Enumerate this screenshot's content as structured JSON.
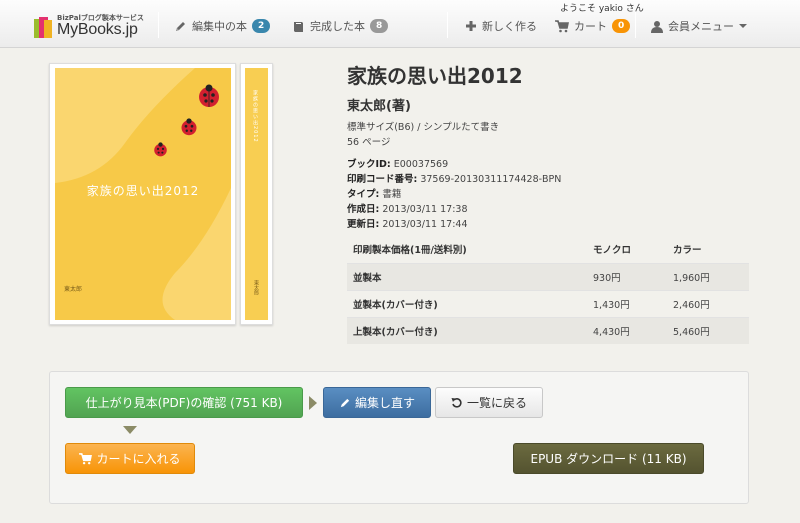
{
  "header": {
    "welcome": "ようこそ yakio さん",
    "logo_tagline": "BizPalブログ製本サービス",
    "logo_text": "MyBooks.jp",
    "nav_editing": {
      "label": "編集中の本",
      "count": "2"
    },
    "nav_done": {
      "label": "完成した本",
      "count": "8"
    },
    "nav_new": "新しく作る",
    "nav_cart": {
      "label": "カート",
      "count": "0"
    },
    "nav_member": "会員メニュー"
  },
  "cover": {
    "title": "家族の思い出2012",
    "author": "東太郎",
    "spine_title": "家族の思い出2012",
    "spine_author": "東太郎"
  },
  "book": {
    "title": "家族の思い出2012",
    "author": "東太郎(著)",
    "format": "標準サイズ(B6) / シンプルたて書き",
    "pages": "56 ページ",
    "book_id_label": "ブックID:",
    "book_id": "E00037569",
    "print_code_label": "印刷コード番号:",
    "print_code": "37569-20130311174428-BPN",
    "type_label": "タイプ:",
    "type": "書籍",
    "created_label": "作成日:",
    "created": "2013/03/11 17:38",
    "updated_label": "更新日:",
    "updated": "2013/03/11 17:44"
  },
  "price_table": {
    "headers": [
      "印刷製本価格(1冊/送料別)",
      "モノクロ",
      "カラー"
    ],
    "rows": [
      [
        "並製本",
        "930円",
        "1,960円"
      ],
      [
        "並製本(カバー付き)",
        "1,430円",
        "2,460円"
      ],
      [
        "上製本(カバー付き)",
        "4,430円",
        "5,460円"
      ]
    ]
  },
  "actions": {
    "preview_pdf": "仕上がり見本(PDF)の確認 (751 KB)",
    "edit_again": "編集し直す",
    "back_to_list": "一覧に戻る",
    "add_to_cart": "カートに入れる",
    "epub_download": "EPUB ダウンロード (11 KB)"
  },
  "colors": {
    "green": "#5bb75b",
    "blue": "#4a7db3",
    "orange": "#f89406",
    "olive": "#5e5d37",
    "cover_yellow": "#f8ce52"
  }
}
